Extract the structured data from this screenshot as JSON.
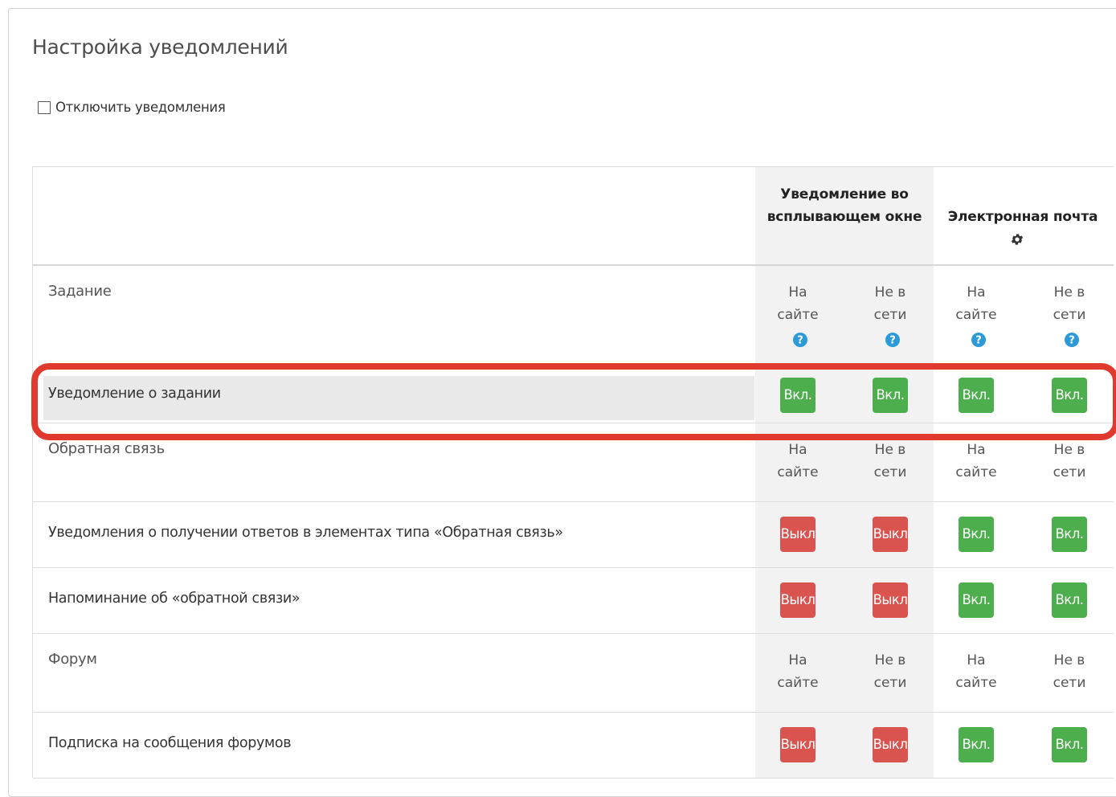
{
  "page": {
    "title": "Настройка уведомлений"
  },
  "disable_notifications": {
    "label": "Отключить уведомления",
    "checked": false
  },
  "table": {
    "header": {
      "popup": "Уведомление во всплывающем окне",
      "email": "Электронная почта",
      "email_icon": "gear-icon"
    },
    "col_labels": {
      "online": [
        "На",
        "сайте"
      ],
      "offline": [
        "Не в",
        "сети"
      ]
    },
    "toggle_labels": {
      "on": "Вкл.",
      "off": "Выкл"
    },
    "sections": [
      {
        "name": "Задание",
        "show_help": true,
        "rows": [
          {
            "label": "Уведомление о задании",
            "highlighted": true,
            "states": [
              "on",
              "on",
              "on",
              "on"
            ]
          }
        ]
      },
      {
        "name": "Обратная связь",
        "show_help": false,
        "rows": [
          {
            "label": "Уведомления о получении ответов в элементах типа «Обратная связь»",
            "highlighted": false,
            "states": [
              "off",
              "off",
              "on",
              "on"
            ]
          },
          {
            "label": "Напоминание об «обратной связи»",
            "highlighted": false,
            "states": [
              "off",
              "off",
              "on",
              "on"
            ]
          }
        ]
      },
      {
        "name": "Форум",
        "show_help": false,
        "rows": [
          {
            "label": "Подписка на сообщения форумов",
            "highlighted": false,
            "states": [
              "off",
              "off",
              "on",
              "on"
            ]
          }
        ]
      }
    ]
  },
  "colors": {
    "on": "#4cae4c",
    "off": "#d9534f",
    "highlight": "#e03a2e",
    "help": "#2b9ad6"
  }
}
